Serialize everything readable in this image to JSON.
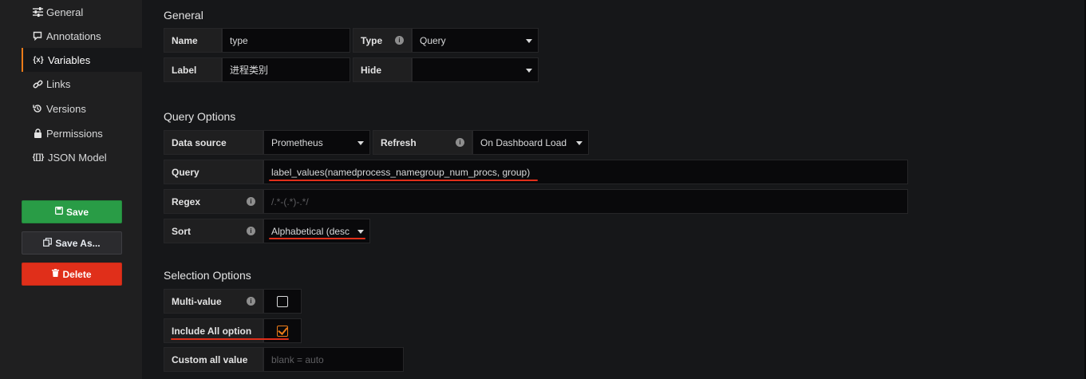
{
  "sidebar": {
    "items": [
      {
        "label": "General",
        "icon": "sliders-icon"
      },
      {
        "label": "Annotations",
        "icon": "comment-icon"
      },
      {
        "label": "Variables",
        "icon": "variable-icon"
      },
      {
        "label": "Links",
        "icon": "link-icon"
      },
      {
        "label": "Versions",
        "icon": "history-icon"
      },
      {
        "label": "Permissions",
        "icon": "lock-icon"
      },
      {
        "label": "JSON Model",
        "icon": "braces-icon"
      }
    ],
    "active": "Variables",
    "save_label": "Save",
    "save_as_label": "Save As...",
    "delete_label": "Delete"
  },
  "general": {
    "title": "General",
    "name_label": "Name",
    "name_value": "type",
    "type_label": "Type",
    "type_value": "Query",
    "label_label": "Label",
    "label_value": "进程类别",
    "hide_label": "Hide",
    "hide_value": ""
  },
  "query_options": {
    "title": "Query Options",
    "datasource_label": "Data source",
    "datasource_value": "Prometheus",
    "refresh_label": "Refresh",
    "refresh_value": "On Dashboard Load",
    "query_label": "Query",
    "query_value": "label_values(namedprocess_namegroup_num_procs, group)",
    "regex_label": "Regex",
    "regex_placeholder": "/.*-(.*)-.*/",
    "sort_label": "Sort",
    "sort_value": "Alphabetical (desc)"
  },
  "selection_options": {
    "title": "Selection Options",
    "multi_value_label": "Multi-value",
    "multi_value_checked": false,
    "include_all_label": "Include All option",
    "include_all_checked": true,
    "custom_all_label": "Custom all value",
    "custom_all_placeholder": "blank = auto"
  },
  "colors": {
    "accent": "#eb7b18",
    "save": "#299c46",
    "delete": "#e02f1a",
    "annotation_underline": "#e02f1a"
  }
}
